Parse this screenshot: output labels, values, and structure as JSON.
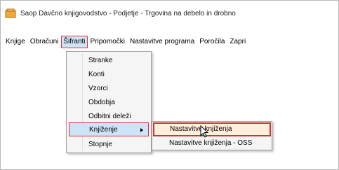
{
  "window": {
    "title": "Saop Davčno knjigovodstvo - Podjetje - Trgovina na debelo in drobno"
  },
  "menubar": {
    "items": [
      {
        "label": "Knjige"
      },
      {
        "label": "Obračuni"
      },
      {
        "label": "Šifranti"
      },
      {
        "label": "Pripomočki"
      },
      {
        "label": "Nastavitve programa"
      },
      {
        "label": "Poročila"
      },
      {
        "label": "Zapri"
      }
    ]
  },
  "dropdown": {
    "items": [
      {
        "label": "Stranke"
      },
      {
        "label": "Konti"
      },
      {
        "label": "Vzorci"
      },
      {
        "label": "Obdobja"
      },
      {
        "label": "Odbitni deleži"
      },
      {
        "label": "Knjiženje"
      },
      {
        "label": "Stopnje"
      }
    ]
  },
  "submenu": {
    "items": [
      {
        "label": "Nastavitve knjiženja"
      },
      {
        "label": "Nastavitve knjiženja - OSS"
      }
    ]
  },
  "colors": {
    "highlight_border": "#d93131",
    "menu_hover": "#cde3f8",
    "submenu_hover": "#fbf0dc"
  }
}
